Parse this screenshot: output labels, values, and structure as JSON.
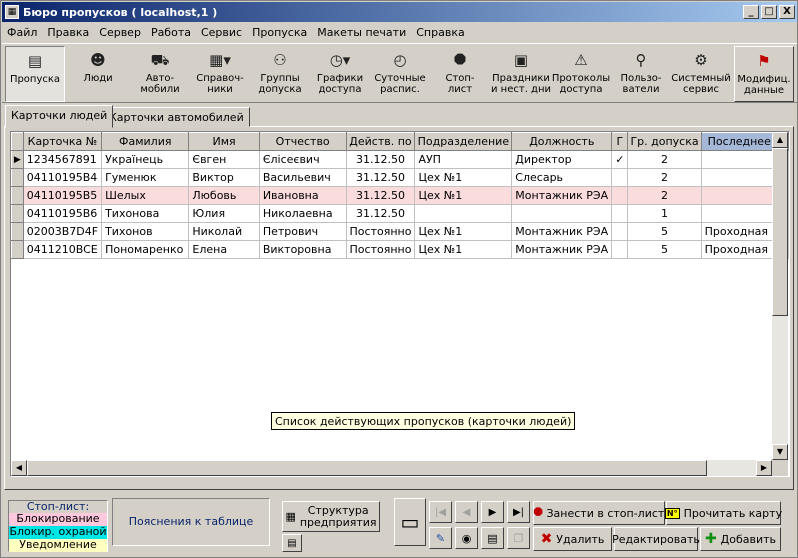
{
  "window": {
    "title": "Бюро пропусков ( localhost,1 )",
    "min_label": "_",
    "max_label": "□",
    "close_label": "X"
  },
  "menu": [
    "Файл",
    "Правка",
    "Сервер",
    "Работа",
    "Сервис",
    "Пропуска",
    "Макеты печати",
    "Справка"
  ],
  "toolbar": [
    {
      "label": "Пропуска",
      "icon": "passes-icon"
    },
    {
      "label": "Люди",
      "icon": "people-icon"
    },
    {
      "label": "Авто-\nмобили",
      "icon": "car-icon"
    },
    {
      "label": "Справоч-\nники",
      "icon": "reference-icon"
    },
    {
      "label": "Группы\nдопуска",
      "icon": "groups-icon"
    },
    {
      "label": "Графики\nдоступа",
      "icon": "schedule-icon"
    },
    {
      "label": "Суточные\nраспис.",
      "icon": "clock-icon"
    },
    {
      "label": "Стоп-\nлист",
      "icon": "stop-icon"
    },
    {
      "label": "Праздники\nи нест. дни",
      "icon": "holidays-icon"
    },
    {
      "label": "Протоколы\nдоступа",
      "icon": "protocol-icon"
    },
    {
      "label": "Пользо-\nватели",
      "icon": "users-icon"
    },
    {
      "label": "Системный\nсервис",
      "icon": "system-service-icon"
    },
    {
      "label": "Модифиц.\nданные",
      "icon": "flag-icon"
    }
  ],
  "tabs": [
    "Карточки людей",
    "Карточки автомобилей"
  ],
  "table": {
    "columns": [
      "Карточка №",
      "Фамилия",
      "Имя",
      "Отчество",
      "Действ. по",
      "Подразделение",
      "Должность",
      "Г",
      "Гр. допуска",
      "Последнее д"
    ],
    "rows": [
      [
        "1234567891",
        "Украïнець",
        "Євген",
        "Єлісеєвич",
        "31.12.50",
        "АУП",
        "Директор",
        "✓",
        "2",
        ""
      ],
      [
        "04110195B4",
        "Гуменюк",
        "Виктор",
        "Васильевич",
        "31.12.50",
        "Цех №1",
        "Слесарь",
        "",
        "2",
        ""
      ],
      [
        "04110195B5",
        "Шелых",
        "Любовь",
        "Ивановна",
        "31.12.50",
        "Цех №1",
        "Монтажник РЭА",
        "",
        "2",
        ""
      ],
      [
        "04110195B6",
        "Тихонова",
        "Юлия",
        "Николаевна",
        "31.12.50",
        "",
        "",
        "",
        "1",
        ""
      ],
      [
        "02003B7D4F",
        "Тихонов",
        "Николай",
        "Петрович",
        "Постоянно",
        "Цех №1",
        "Монтажник РЭА",
        "",
        "5",
        "Проходная"
      ],
      [
        "0411210BCE",
        "Пономаренко",
        "Елена",
        "Викторовна",
        "Постоянно",
        "Цех №1",
        "Монтажник РЭА",
        "",
        "5",
        "Проходная"
      ]
    ]
  },
  "tooltip": "Список действующих пропусков  (карточки людей)",
  "legend": {
    "title": "Стоп-лист:",
    "items": [
      "Блокирование",
      "Блокир. охраной",
      "Уведомление"
    ]
  },
  "explain_label": "Пояснения к таблице",
  "structure_label": "Структура\nпредприятия",
  "buttons": {
    "stoplist": "Занести в стоп-лист",
    "read_card": "Прочитать карту",
    "delete": "Удалить",
    "edit": "Редактировать",
    "add": "Добавить"
  },
  "colors": {
    "pink_row": "#fadcdc",
    "title_start": "#0a246a"
  }
}
